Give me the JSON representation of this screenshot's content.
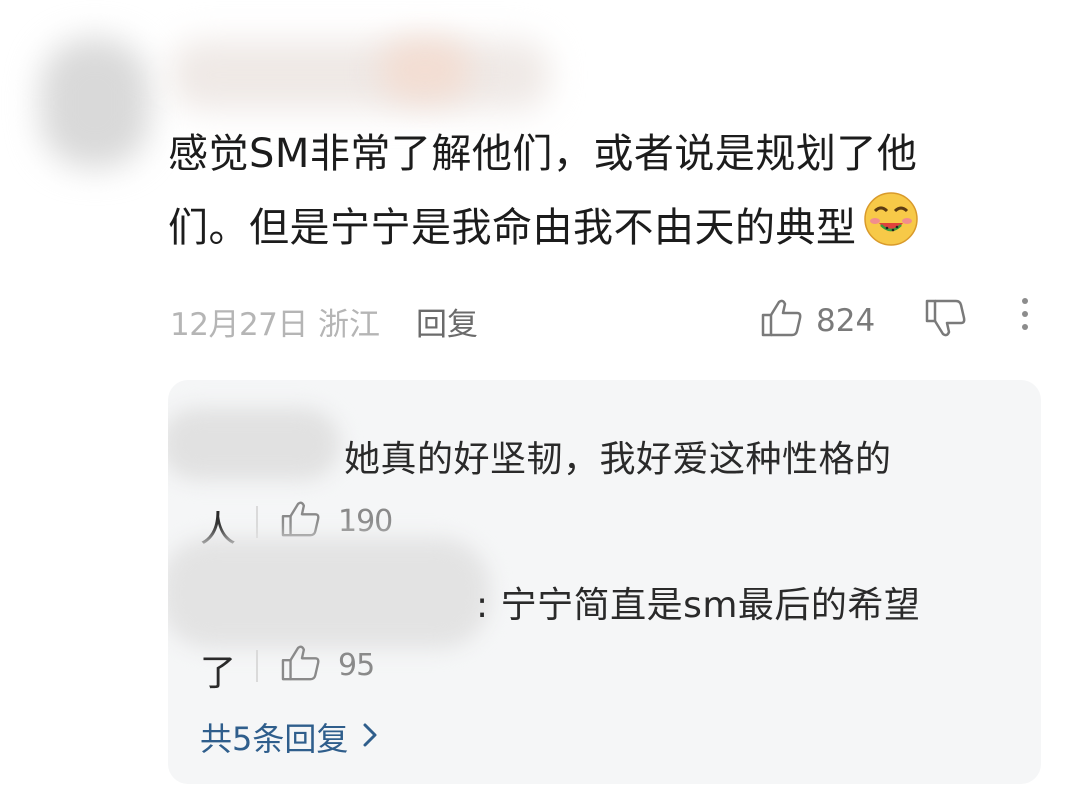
{
  "comment": {
    "line1": "感觉SM非常了解他们，或者说是规划了他",
    "line2": "们。但是宁宁是我命由我不由天的典型",
    "emoji_icon": "laughing-eating-watermelon-emoji",
    "date": "12月27日",
    "location": "浙江",
    "reply_label": "回复",
    "like_count": "824"
  },
  "replies": [
    {
      "line1": "她真的好坚韧，我好爱这种性格的",
      "line2": "人",
      "like_count": "190"
    },
    {
      "line1": ": 宁宁简直是sm最后的希望",
      "line2": "了",
      "like_count": "95"
    }
  ],
  "more_replies_label": "共5条回复",
  "colors": {
    "meta": "#b5b5b5",
    "link": "#2f5e8c",
    "reply_bg": "#f5f6f7"
  }
}
